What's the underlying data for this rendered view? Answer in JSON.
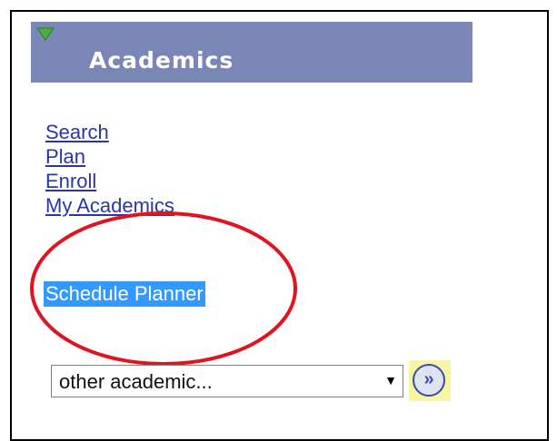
{
  "panel": {
    "title": "Academics",
    "collapse_icon": "triangle-down-icon"
  },
  "links": [
    {
      "label": "Search"
    },
    {
      "label": "Plan"
    },
    {
      "label": "Enroll"
    },
    {
      "label": "My Academics"
    }
  ],
  "highlighted_link": {
    "label": "Schedule Planner"
  },
  "other_academic": {
    "selected_value": "other academic...",
    "go_button_icon": "double-chevron-right-icon"
  },
  "colors": {
    "header_bg": "#7a86b6",
    "link": "#2a36a8",
    "selection_bg": "#3399ff",
    "annotation_circle": "#e0141e",
    "go_button_bg": "#f7f5a0"
  }
}
